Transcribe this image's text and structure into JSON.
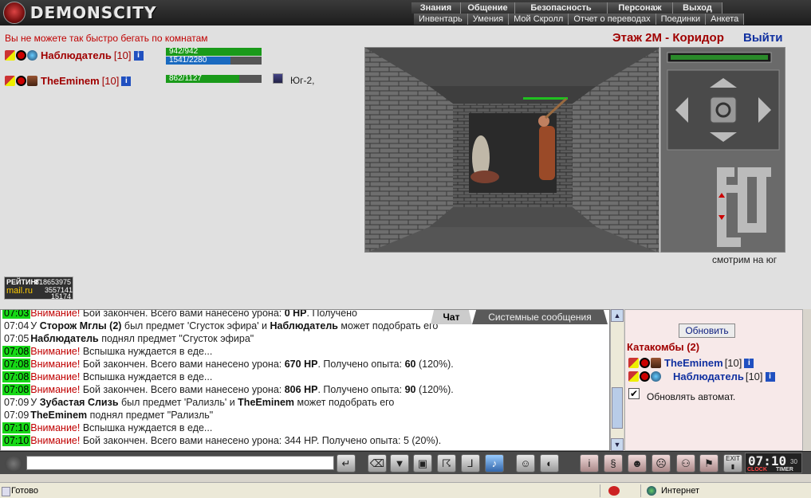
{
  "app": {
    "title": "DEMONSCITY"
  },
  "nav_top": [
    "Знания",
    "Общение",
    "Безопасность",
    "Персонаж",
    "Выход"
  ],
  "nav_bottom": [
    "Инвентарь",
    "Умения",
    "Мой Скролл",
    "Отчет о переводах",
    "Поединки",
    "Анкета"
  ],
  "warning": "Вы не можете так быстро бегать по комнатам",
  "location": "Этаж 2М - Коридор",
  "exit_link": "Выйти",
  "players": [
    {
      "name": "Наблюдатель",
      "level": "[10]",
      "hp_text": "942/942",
      "mp_text": "1541/2280",
      "hp_frac": 1.0,
      "mp_frac": 0.676
    },
    {
      "name": "TheEminem",
      "level": "[10]",
      "hp_text": "862/1127",
      "hp_frac": 0.765
    }
  ],
  "direction_text": "Юг-2,",
  "view_direction": "смотрим на юг",
  "rating": {
    "label": "РЕЙТИНГ",
    "n1": "818653975",
    "brand": "mail.ru",
    "n2": "3557141",
    "n3": "15174"
  },
  "tabs": {
    "chat": "Чат",
    "system": "Системные сообщения"
  },
  "chat": [
    {
      "time": "07:03",
      "green": true,
      "parts": [
        [
          "red",
          "Внимание!"
        ],
        [
          "t",
          " Бой закончен. Всего вами нанесено урона: "
        ],
        [
          "b",
          "0 HP"
        ],
        [
          "t",
          ". Получено"
        ]
      ]
    },
    {
      "time": "07:04",
      "green": false,
      "parts": [
        [
          "t",
          "У "
        ],
        [
          "b",
          "Сторож Мглы (2)"
        ],
        [
          "t",
          " был предмет 'Сгусток эфира' и "
        ],
        [
          "b",
          "Наблюдатель"
        ],
        [
          "t",
          " может подобрать его"
        ]
      ]
    },
    {
      "time": "07:05",
      "green": false,
      "parts": [
        [
          "b",
          "Наблюдатель"
        ],
        [
          "t",
          " поднял предмет \"Сгусток эфира\""
        ]
      ]
    },
    {
      "time": "07:08",
      "green": true,
      "parts": [
        [
          "red",
          "Внимание!"
        ],
        [
          "t",
          " Вспышка нуждается в еде..."
        ]
      ]
    },
    {
      "time": "07:08",
      "green": true,
      "parts": [
        [
          "red",
          "Внимание!"
        ],
        [
          "t",
          " Бой закончен. Всего вами нанесено урона: "
        ],
        [
          "b",
          "670 HP"
        ],
        [
          "t",
          ". Получено опыта: "
        ],
        [
          "b",
          "60"
        ],
        [
          "t",
          " (120%)."
        ]
      ]
    },
    {
      "time": "07:08",
      "green": true,
      "parts": [
        [
          "red",
          "Внимание!"
        ],
        [
          "t",
          " Вспышка нуждается в еде..."
        ]
      ]
    },
    {
      "time": "07:08",
      "green": true,
      "parts": [
        [
          "red",
          "Внимание!"
        ],
        [
          "t",
          " Бой закончен. Всего вами нанесено урона: "
        ],
        [
          "b",
          "806 HP"
        ],
        [
          "t",
          ". Получено опыта: "
        ],
        [
          "b",
          "90"
        ],
        [
          "t",
          " (120%)."
        ]
      ]
    },
    {
      "time": "07:09",
      "green": false,
      "parts": [
        [
          "t",
          "У "
        ],
        [
          "b",
          "Зубастая Слизь"
        ],
        [
          "t",
          " был предмет 'Рализль' и "
        ],
        [
          "b",
          "TheEminem"
        ],
        [
          "t",
          " может подобрать его"
        ]
      ]
    },
    {
      "time": "07:09",
      "green": false,
      "parts": [
        [
          "b",
          "TheEminem"
        ],
        [
          "t",
          " поднял предмет \"Рализль\""
        ]
      ]
    },
    {
      "time": "07:10",
      "green": true,
      "parts": [
        [
          "red",
          "Внимание!"
        ],
        [
          "t",
          " Вспышка нуждается в еде..."
        ]
      ]
    },
    {
      "time": "07:10",
      "green": true,
      "parts": [
        [
          "red",
          "Внимание!"
        ],
        [
          "t",
          " Бой закончен. Всего вами нанесено урона: "
        ],
        [
          "t",
          "344 HP"
        ],
        [
          "t",
          ". Получено опыта: "
        ],
        [
          "t",
          "5"
        ],
        [
          "t",
          " (20%)."
        ]
      ]
    }
  ],
  "right_panel": {
    "refresh_button": "Обновить",
    "room_title": "Катакомбы (2)",
    "players": [
      {
        "name": "TheEminem",
        "level": "[10]"
      },
      {
        "name": "Наблюдатель",
        "level": "[10]"
      }
    ],
    "auto_refresh_label": "Обновлять автомат.",
    "auto_refresh_checked": true
  },
  "clock": {
    "time": "07:10",
    "seconds": "30",
    "label_clock": "CLOCK",
    "label_timer": "TIMER"
  },
  "toolbar_exit": "EXIT",
  "status": {
    "ready": "Готово",
    "zone": "Интернет"
  },
  "colors": {
    "accent_red": "#a00000",
    "link_blue": "#1030a0",
    "time_green": "#16d816"
  }
}
